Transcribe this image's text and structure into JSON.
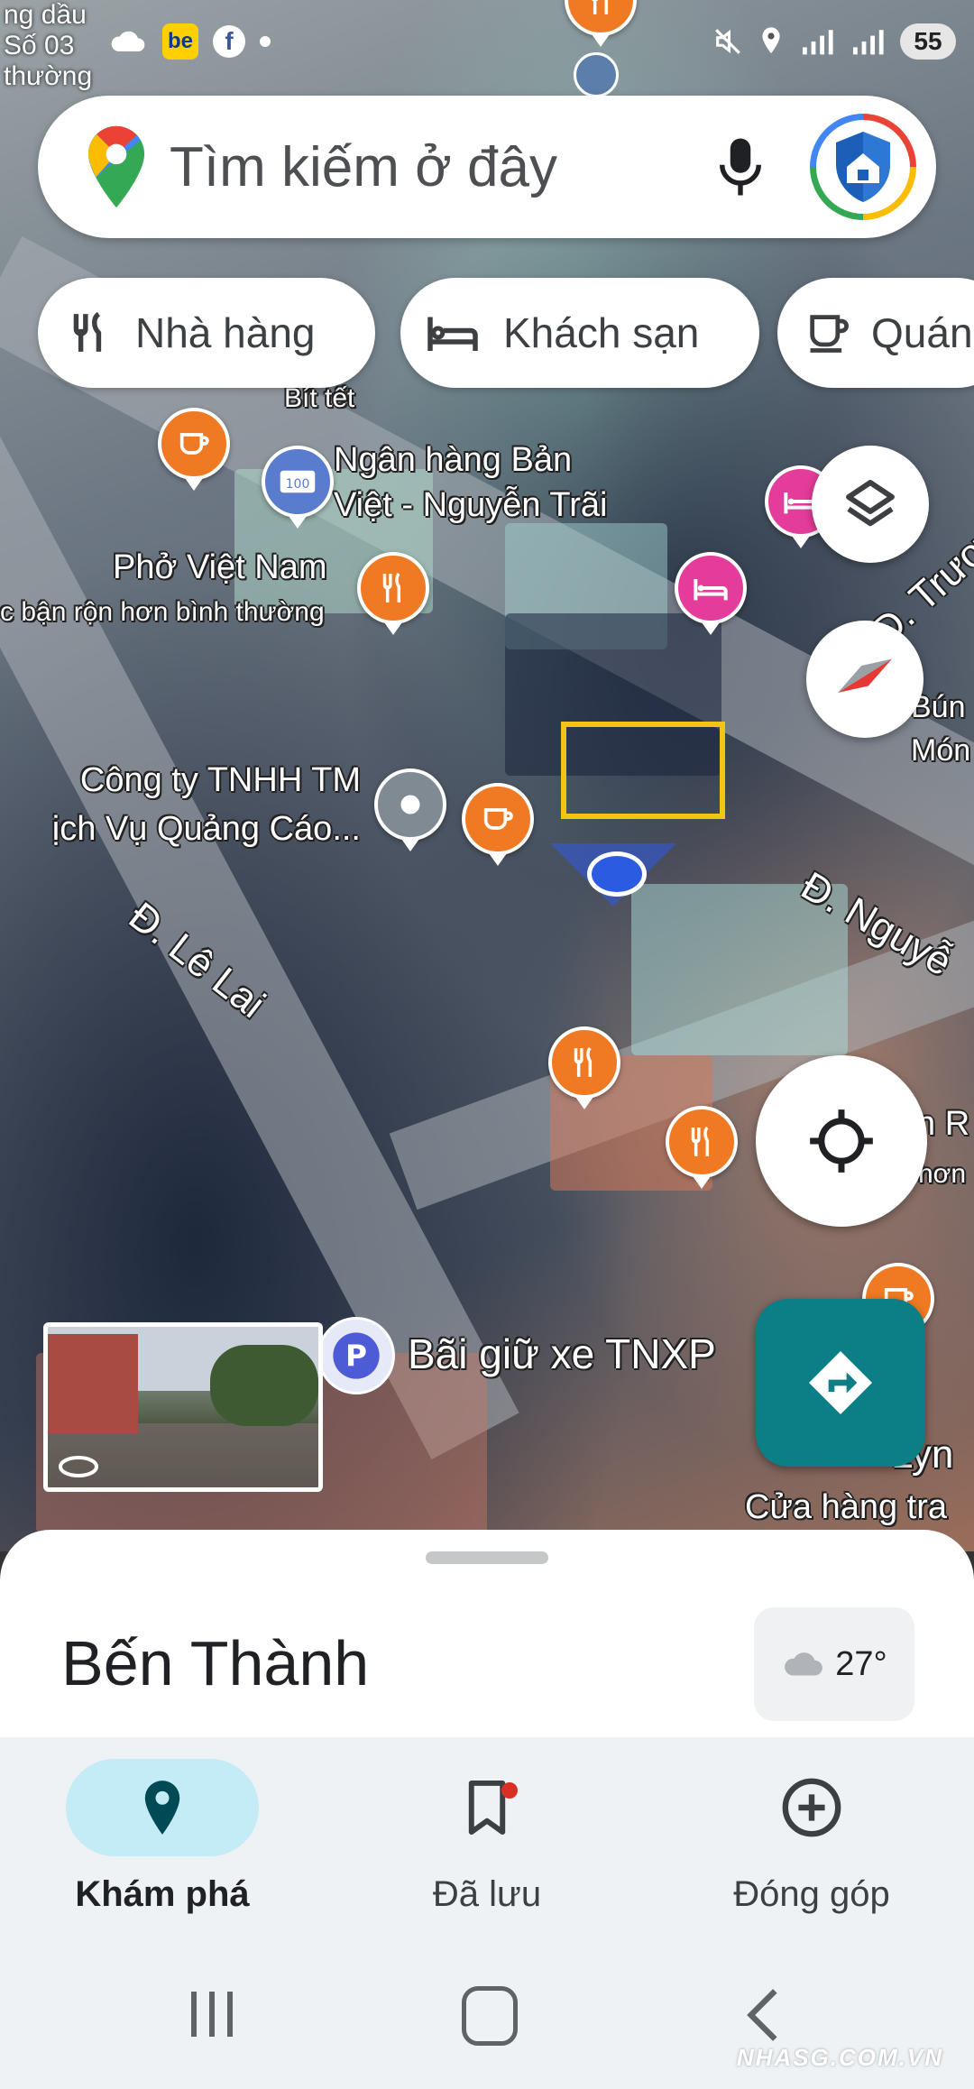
{
  "status_bar": {
    "left_text": "ng dầu\nSố 03\nthường",
    "battery": "55"
  },
  "search": {
    "placeholder": "Tìm kiếm ở đây"
  },
  "chips": [
    {
      "label": "Nhà hàng",
      "icon": "fork-knife-icon"
    },
    {
      "label": "Khách sạn",
      "icon": "bed-icon"
    },
    {
      "label": "Quán",
      "icon": "coffee-cup-icon"
    }
  ],
  "map_labels": {
    "bit_tet": "Bít tết",
    "bank": "Ngân hàng Bản\nViệt - Nguyễn Trãi",
    "pho": "Phở Việt Nam",
    "busy_note": "c bận rộn hơn bình thường",
    "company": "Công ty TNHH TM\nịch Vụ Quảng Cáo...",
    "street_le_lai": "Đ. Lê Lai",
    "street_nguyen": "Đ. Nguyễ",
    "street_truong": "Đ. Trươ",
    "bun": "Bún\nMón",
    "parking": "Bãi giữ xe TNXP",
    "lyn": "Lyn",
    "store": "Cửa hàng tra",
    "right_r": "n R",
    "right_hon": "hơn"
  },
  "sheet": {
    "place_title": "Bến Thành",
    "temperature": "27°"
  },
  "nav": {
    "tabs": [
      {
        "label": "Khám phá",
        "icon": "location-pin-icon",
        "active": true
      },
      {
        "label": "Đã lưu",
        "icon": "bookmark-icon",
        "active": false
      },
      {
        "label": "Đóng góp",
        "icon": "add-circle-icon",
        "active": false
      }
    ]
  },
  "watermark": "NHASG.COM.VN",
  "colors": {
    "accent_teal": "#0c7f86",
    "active_tab_bg": "#c3ecf6",
    "highlight_box": "#f2c417"
  }
}
